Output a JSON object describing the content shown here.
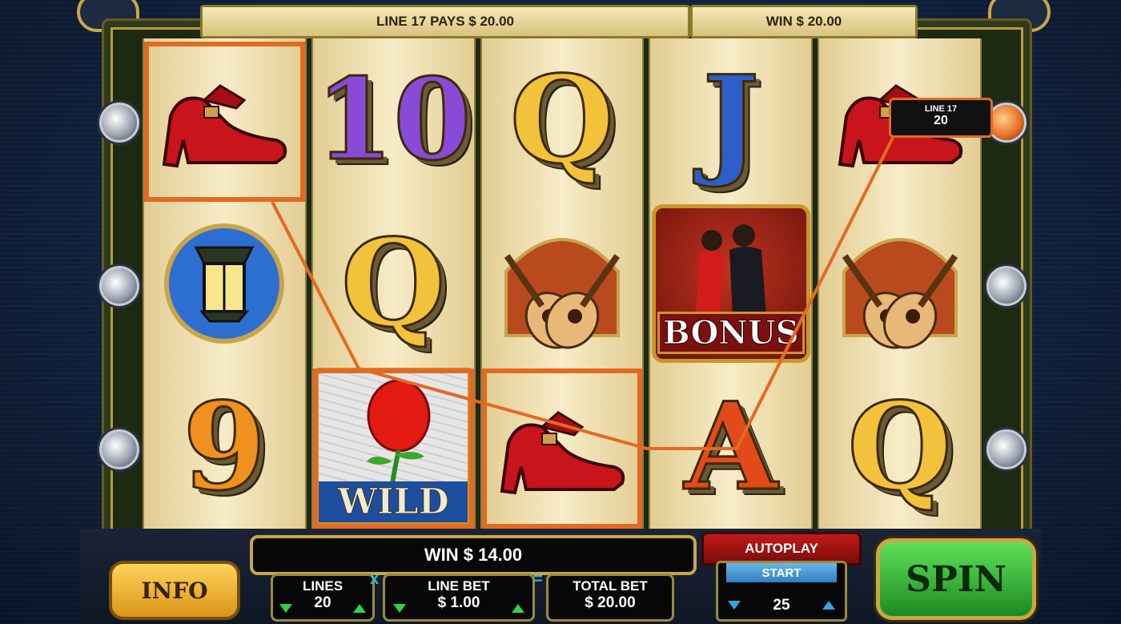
{
  "header": {
    "line_pays": "LINE 17 PAYS $ 20.00",
    "win": "WIN $ 20.00"
  },
  "line_marker": {
    "label": "LINE 17",
    "value": "20"
  },
  "reels": [
    [
      "red-shoe",
      "street-lamp",
      "nine"
    ],
    [
      "ten",
      "queen",
      "wild-rose"
    ],
    [
      "queen",
      "guitars",
      "red-shoe"
    ],
    [
      "jack",
      "bonus-dancers",
      "ace"
    ],
    [
      "red-shoe",
      "guitars",
      "queen"
    ]
  ],
  "symbols": {
    "ten": "10",
    "queen": "Q",
    "jack": "J",
    "ace": "A",
    "nine": "9",
    "bonus_label": "BONUS",
    "wild_label": "WILD"
  },
  "colors": {
    "highlight": "#e36a22",
    "frame_gold": "#c9a648",
    "spin_green": "#2fb52f",
    "autoplay_red": "#b01717"
  },
  "bottom": {
    "win": "WIN $ 14.00",
    "info_label": "INFO",
    "lines_label": "LINES",
    "lines_value": "20",
    "times": "x",
    "line_bet_label": "LINE BET",
    "line_bet_value": "$ 1.00",
    "equals": "=",
    "total_bet_label": "TOTAL BET",
    "total_bet_value": "$ 20.00",
    "autoplay_label": "AUTOPLAY",
    "autoplay_start": "START",
    "autoplay_value": "25",
    "spin_label": "SPIN"
  }
}
